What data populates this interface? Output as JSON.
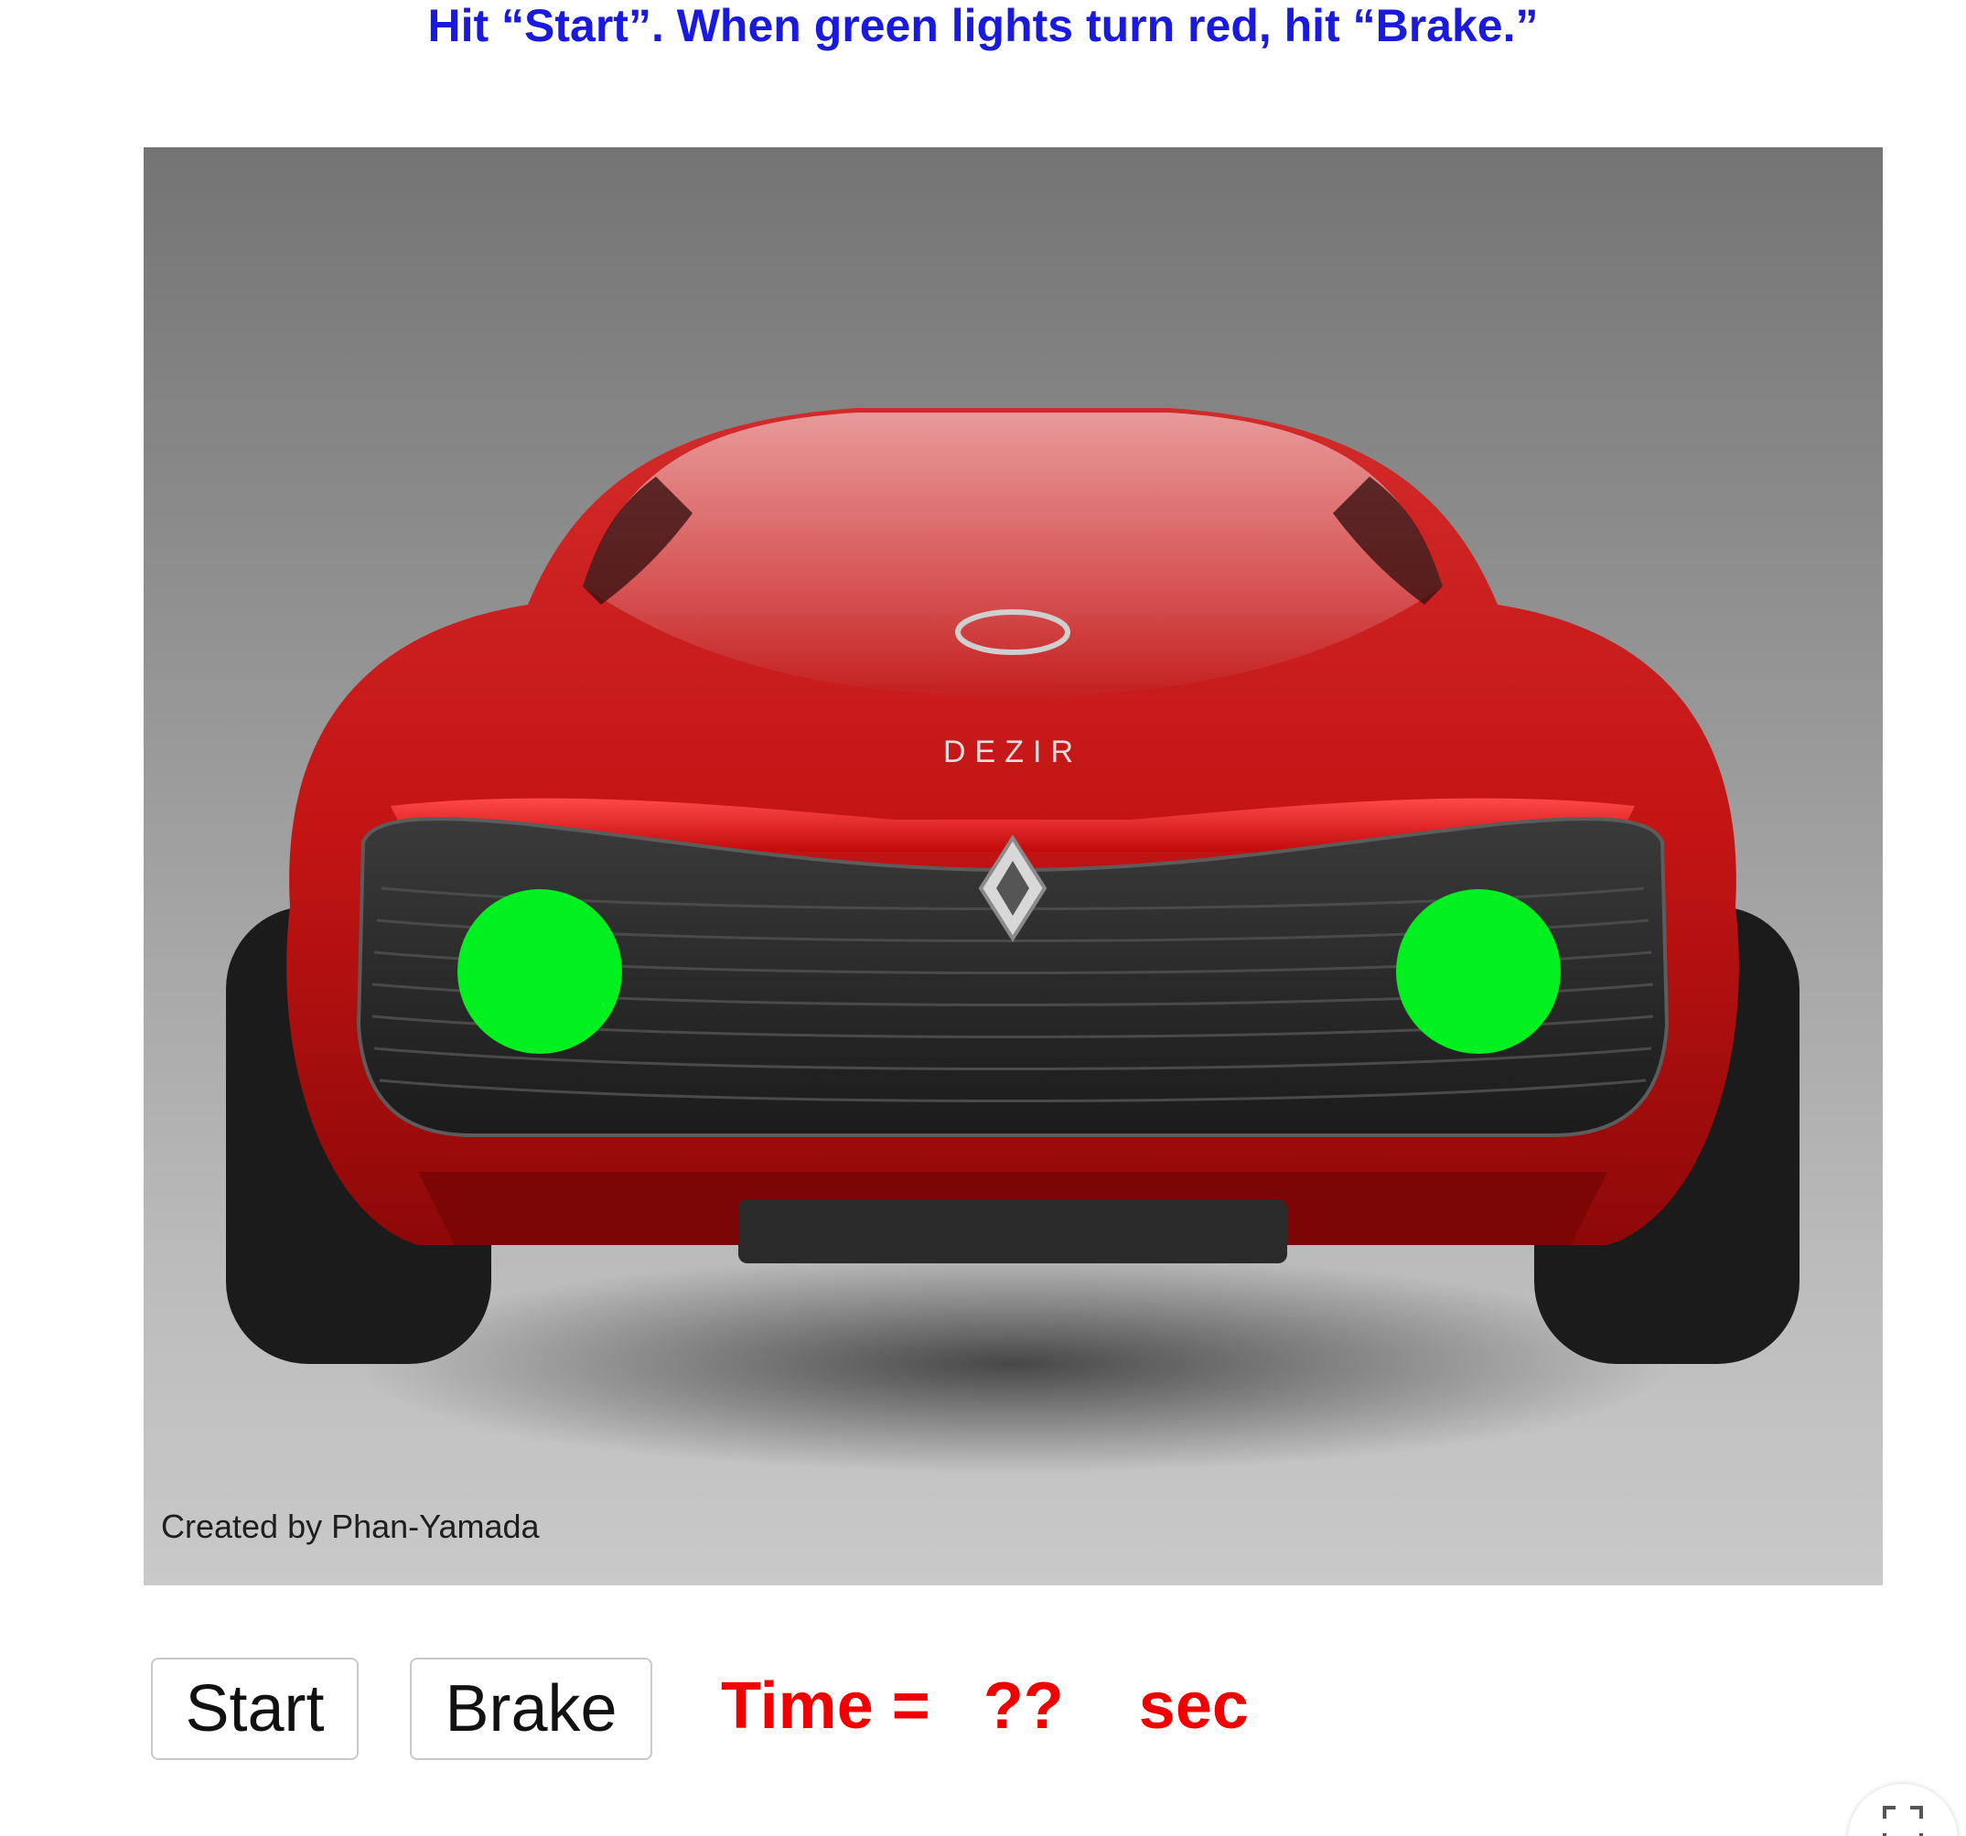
{
  "instructions": "Hit “Start”.  When green lights turn red, hit “Brake.”",
  "credit": "Created by Phan-Yamada",
  "car": {
    "image_icon": "red-sports-car-rear-view",
    "badge_text": "DEZIR"
  },
  "lights": {
    "state": "green",
    "color": "#00f020"
  },
  "controls": {
    "start_label": "Start",
    "brake_label": "Brake"
  },
  "timer": {
    "label": "Time =",
    "value": "??",
    "unit": "sec"
  },
  "colors": {
    "instructions": "#1a1adf",
    "timer": "#f00000"
  },
  "fullscreen_icon": "fullscreen-icon"
}
